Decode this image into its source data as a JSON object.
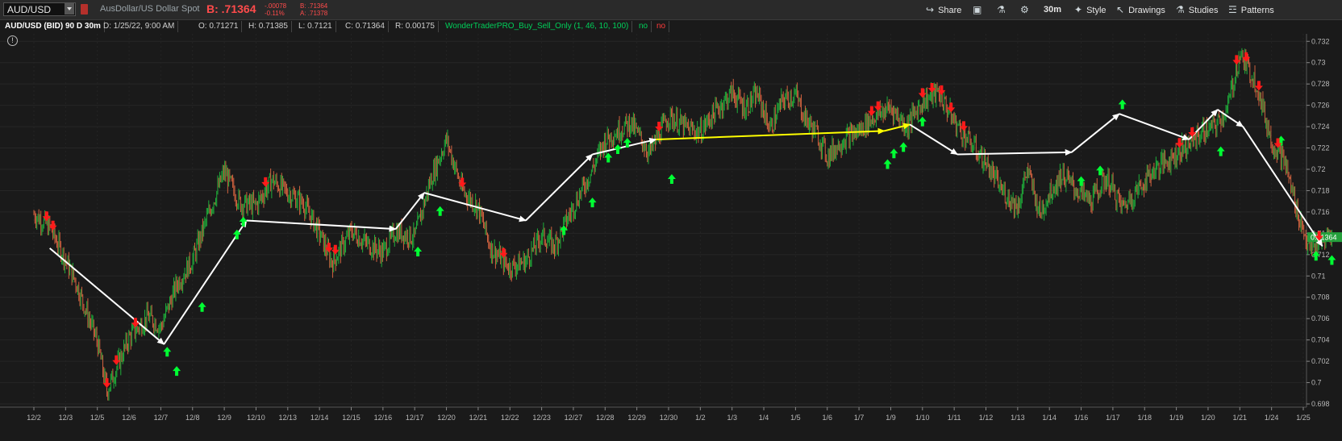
{
  "toolbar": {
    "symbol": "AUD/USD",
    "description": "AusDollar/US Dollar Spot",
    "bid": "B: .71364",
    "change": "-.00078",
    "change_pct": "-0.11%",
    "bid_small": "B: .71364",
    "ask_small": "A: .71378",
    "share": "Share",
    "timeframe": "30m",
    "style": "Style",
    "drawings": "Drawings",
    "studies": "Studies",
    "patterns": "Patterns",
    "icons": [
      "share-icon",
      "save-icon",
      "flask-icon",
      "gear-icon",
      "style-icon",
      "cursor-icon",
      "studies-icon",
      "patterns-icon"
    ]
  },
  "infobar": {
    "symbol_period": "AUD/USD (BID) 90 D 30m",
    "date": "D: 1/25/22, 9:00 AM",
    "open": "O: 0.71271",
    "high": "H: 0.71385",
    "low": "L: 0.7121",
    "close": "C: 0.71364",
    "range": "R: 0.00175",
    "study": "WonderTraderPRO_Buy_Sell_Only (1, 46, 10, 100)",
    "flag_up": "no",
    "flag_down": "no"
  },
  "colors": {
    "background": "#1a1a1a",
    "up_candle": "#1fae3a",
    "down_candle": "#d0623f",
    "buy_arrow": "#00ff33",
    "sell_arrow": "#ff1a1a",
    "trend_line": "#ffffff",
    "highlight_line": "#ffff00",
    "price_tag": "#25a03c"
  },
  "chart_data": {
    "type": "line",
    "symbol": "AUD/USD",
    "x_ticks": [
      "12/2",
      "12/3",
      "12/5",
      "12/6",
      "12/7",
      "12/8",
      "12/9",
      "12/10",
      "12/13",
      "12/14",
      "12/15",
      "12/16",
      "12/17",
      "12/20",
      "12/21",
      "12/22",
      "12/23",
      "12/27",
      "12/28",
      "12/29",
      "12/30",
      "1/2",
      "1/3",
      "1/4",
      "1/5",
      "1/6",
      "1/7",
      "1/9",
      "1/10",
      "1/11",
      "1/12",
      "1/13",
      "1/14",
      "1/16",
      "1/17",
      "1/18",
      "1/19",
      "1/20",
      "1/21",
      "1/24",
      "1/25"
    ],
    "y_ticks": [
      "0.698",
      "0.7",
      "0.702",
      "0.704",
      "0.706",
      "0.708",
      "0.71",
      "0.712",
      "0.714",
      "0.716",
      "0.718",
      "0.72",
      "0.722",
      "0.724",
      "0.726",
      "0.728",
      "0.73",
      "0.732"
    ],
    "ylim": [
      0.6977,
      0.7327
    ],
    "last_price": "0.71364",
    "price_path_x": [
      0,
      0.5,
      1.3,
      2,
      2.3,
      3,
      3.6,
      4,
      4.5,
      5.0,
      5.5,
      6.0,
      6.5,
      7.0,
      7.5,
      8.0,
      8.5,
      9.0,
      9.4,
      10.0,
      10.5,
      11.0,
      11.4,
      12.0,
      12.5,
      13.0,
      13.5,
      14.0,
      14.4,
      15.0,
      15.5,
      16.0,
      16.4,
      17.0,
      17.6,
      18.0,
      18.8,
      19.4,
      20.0,
      20.6,
      21.0,
      21.3,
      21.7,
      22.0,
      22.4,
      22.8,
      23.2,
      23.6,
      24.0,
      24.3,
      24.7,
      25.0,
      25.5,
      26.0,
      26.5,
      27.0,
      27.5,
      28.0,
      28.5,
      29.0,
      29.5,
      30.0,
      30.5,
      31.0,
      31.3,
      31.7,
      32.0,
      32.4,
      32.8,
      33.3,
      33.8,
      34.3,
      34.8,
      35.3,
      35.8,
      36.3,
      36.8,
      37.2,
      37.6,
      38.0,
      38.5,
      39.0,
      39.4,
      39.8,
      40.2,
      40.6,
      40.9
    ],
    "price_path_y": [
      0.7158,
      0.7146,
      0.7096,
      0.7038,
      0.6992,
      0.7042,
      0.7062,
      0.7052,
      0.7092,
      0.7115,
      0.7158,
      0.7198,
      0.7168,
      0.7166,
      0.719,
      0.7178,
      0.7168,
      0.714,
      0.7112,
      0.7142,
      0.713,
      0.7122,
      0.7142,
      0.7136,
      0.719,
      0.7228,
      0.718,
      0.7164,
      0.7126,
      0.7108,
      0.7114,
      0.7138,
      0.7128,
      0.7165,
      0.72,
      0.7228,
      0.7244,
      0.7215,
      0.725,
      0.7238,
      0.7235,
      0.7248,
      0.7262,
      0.7272,
      0.7258,
      0.727,
      0.7238,
      0.7265,
      0.727,
      0.7248,
      0.7232,
      0.7212,
      0.7228,
      0.7236,
      0.725,
      0.7258,
      0.724,
      0.7264,
      0.7272,
      0.7245,
      0.7225,
      0.7206,
      0.718,
      0.7165,
      0.72,
      0.7158,
      0.7178,
      0.7195,
      0.7182,
      0.717,
      0.7192,
      0.7164,
      0.7182,
      0.72,
      0.721,
      0.7222,
      0.7235,
      0.724,
      0.7256,
      0.7308,
      0.7282,
      0.7226,
      0.7208,
      0.7162,
      0.7124,
      0.7132,
      0.714
    ],
    "trend_lines": [
      {
        "x": [
          0.5,
          4.1,
          6.7,
          11.4,
          12.3,
          15.5,
          17.6,
          19.6
        ],
        "y": [
          0.7126,
          0.7036,
          0.7152,
          0.7144,
          0.7178,
          0.7152,
          0.7214,
          0.7228
        ],
        "color": "white"
      },
      {
        "x": [
          19.6,
          26.8,
          27.6
        ],
        "y": [
          0.7228,
          0.7236,
          0.7242
        ],
        "color": "yellow"
      },
      {
        "x": [
          27.6,
          29.1,
          32.7,
          34.2,
          36.4,
          37.3,
          38.1,
          40.6
        ],
        "y": [
          0.7242,
          0.7214,
          0.7216,
          0.7252,
          0.7228,
          0.7256,
          0.724,
          0.7128
        ],
        "color": "white"
      }
    ],
    "buy_signals_x": [
      4.2,
      4.5,
      5.3,
      6.4,
      6.6,
      12.1,
      12.8,
      16.7,
      17.6,
      18.1,
      18.4,
      18.7,
      20.1,
      26.9,
      27.1,
      27.4,
      28.0,
      33.0,
      33.6,
      34.3,
      37.4,
      39.3,
      40.4,
      40.9
    ],
    "buy_signals_y": [
      0.7038,
      0.702,
      0.708,
      0.7148,
      0.716,
      0.7132,
      0.717,
      0.7152,
      0.7178,
      0.722,
      0.7228,
      0.7234,
      0.72,
      0.7214,
      0.7224,
      0.723,
      0.7254,
      0.7198,
      0.7208,
      0.727,
      0.7226,
      0.7236,
      0.7128,
      0.7124
    ],
    "sell_signals_x": [
      0.4,
      0.6,
      2.3,
      2.6,
      3.2,
      7.3,
      9.3,
      9.5,
      13.5,
      14.8,
      19.7,
      26.4,
      26.6,
      28.0,
      28.3,
      28.6,
      28.9,
      29.3,
      36.1,
      36.5,
      37.9,
      38.2,
      38.6,
      39.2,
      40.5
    ]
  }
}
